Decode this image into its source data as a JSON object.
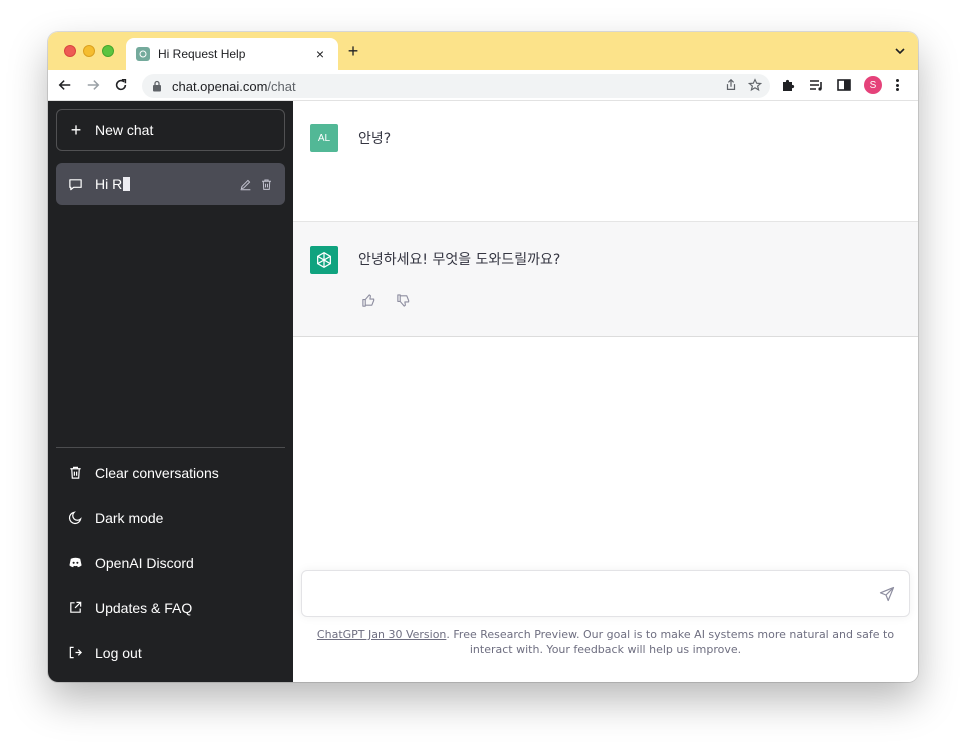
{
  "browser": {
    "tab_title": "Hi Request Help",
    "tab_close": "×",
    "new_tab": "+",
    "url_host": "chat.openai.com",
    "url_path": "/chat",
    "profile_initial": "S",
    "colors": {
      "tab_strip": "#fce38a",
      "profile": "#e5427a"
    }
  },
  "sidebar": {
    "new_chat_label": "New chat",
    "new_chat_icon": "+",
    "conversations": [
      {
        "label": "Hi R"
      }
    ],
    "links": [
      {
        "label": "Clear conversations",
        "icon": "trash-icon"
      },
      {
        "label": "Dark mode",
        "icon": "moon-icon"
      },
      {
        "label": "OpenAI Discord",
        "icon": "discord-icon"
      },
      {
        "label": "Updates & FAQ",
        "icon": "external-link-icon"
      },
      {
        "label": "Log out",
        "icon": "logout-icon"
      }
    ],
    "colors": {
      "background": "#202123",
      "selected": "#4b4c55"
    }
  },
  "conversation": {
    "user_avatar": "AL",
    "user_message": "안녕?",
    "assistant_message": "안녕하세요! 무엇을 도와드릴까요?",
    "colors": {
      "user_avatar": "#52b896",
      "assistant_avatar": "#10a37f"
    }
  },
  "composer": {
    "placeholder": ""
  },
  "footer": {
    "version_link": "ChatGPT Jan 30 Version",
    "note": ". Free Research Preview. Our goal is to make AI systems more natural and safe to interact with. Your feedback will help us improve."
  }
}
